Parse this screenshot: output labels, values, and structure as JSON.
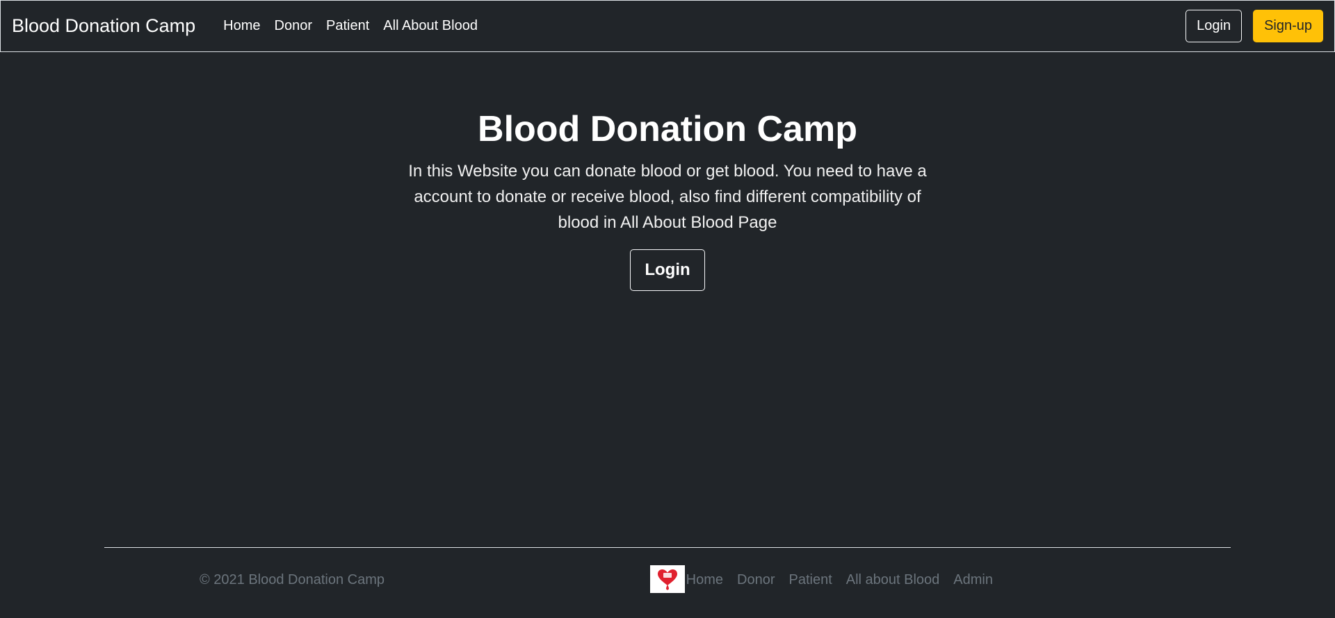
{
  "navbar": {
    "brand": "Blood Donation Camp",
    "links": [
      "Home",
      "Donor",
      "Patient",
      "All About Blood"
    ],
    "login_label": "Login",
    "signup_label": "Sign-up"
  },
  "hero": {
    "title": "Blood Donation Camp",
    "lead": "In this Website you can donate blood or get blood. You need to have a account to donate or receive blood, also find different compatibility of blood in All About Blood Page",
    "button_label": "Login"
  },
  "footer": {
    "copyright": "© 2021 Blood Donation Camp",
    "logo_icon": "blood-drop-heart-icon",
    "links": [
      "Home",
      "Donor",
      "Patient",
      "All about Blood",
      "Admin"
    ]
  },
  "colors": {
    "background": "#212529",
    "accent": "#ffc107",
    "muted": "#6c757d",
    "logo_red": "#e0202e"
  }
}
